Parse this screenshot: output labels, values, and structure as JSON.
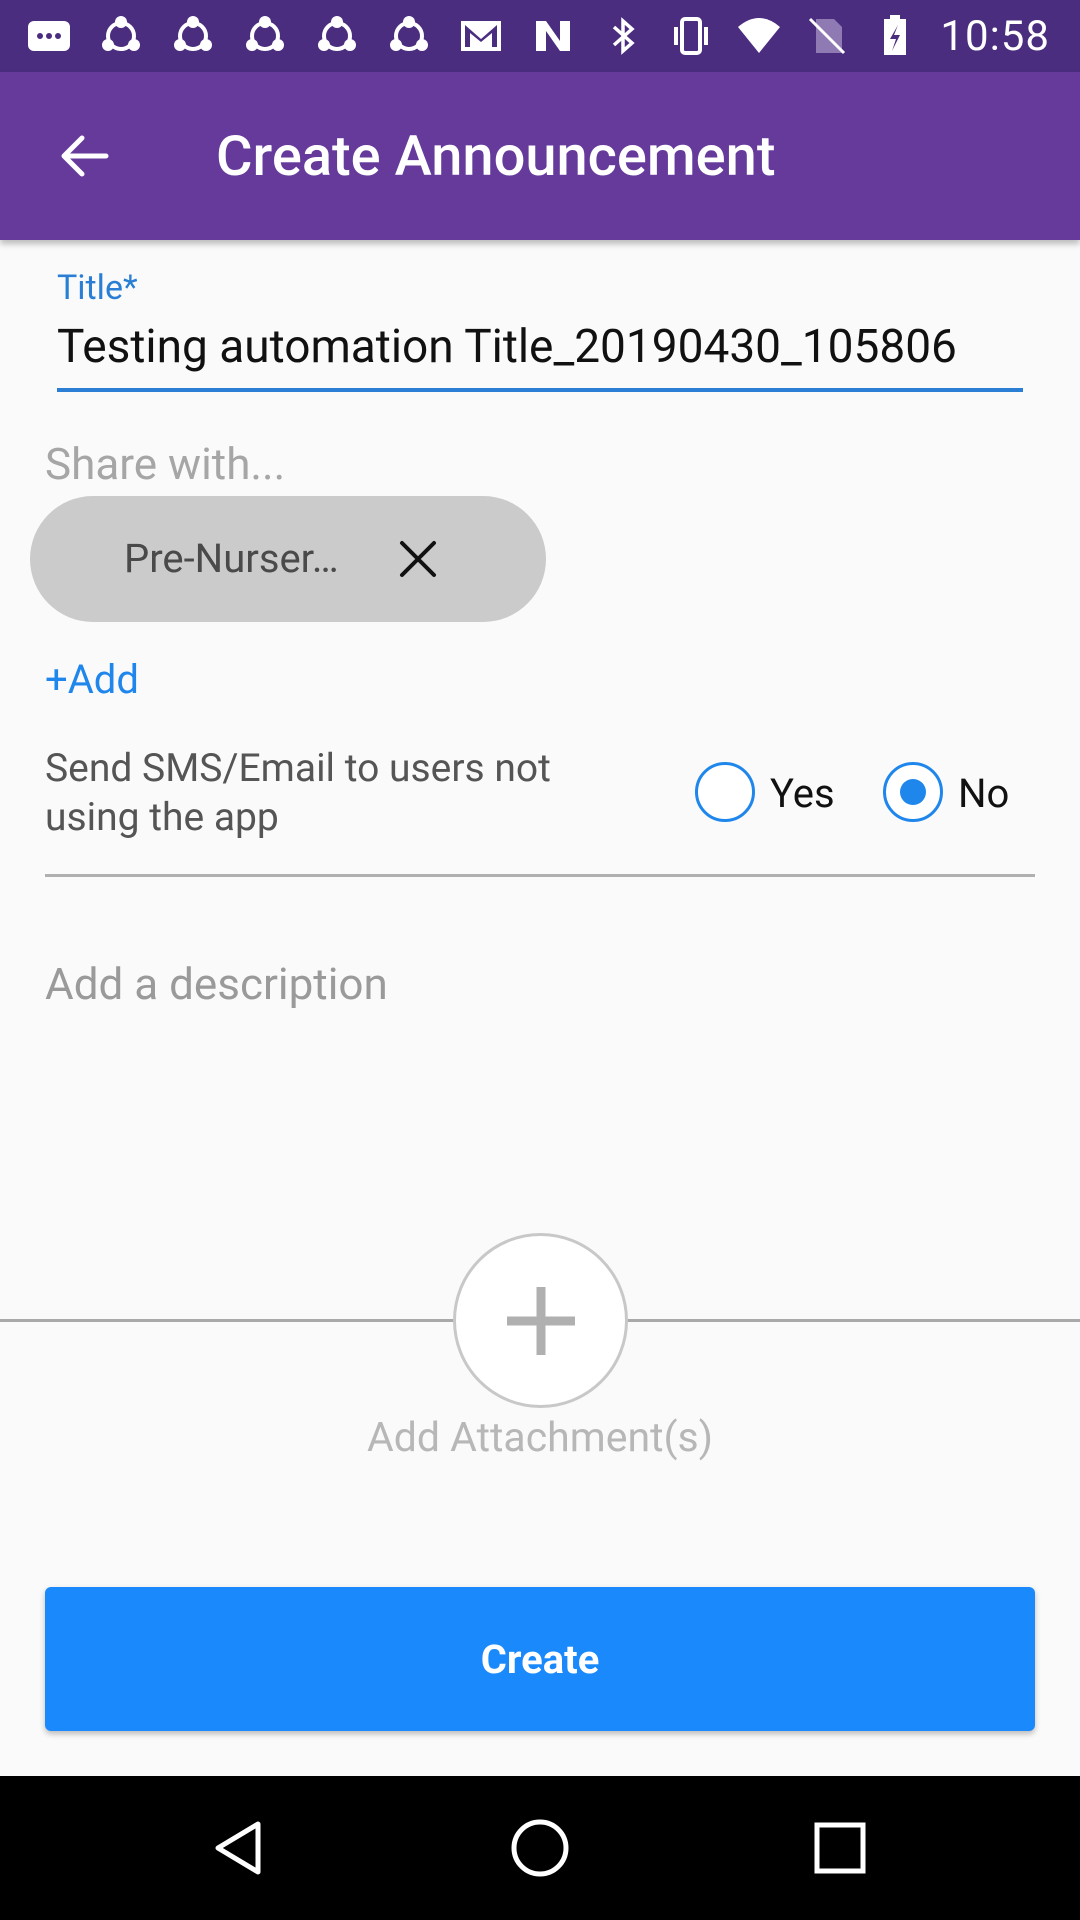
{
  "status_bar": {
    "time": "10:58",
    "icons": [
      "message-icon",
      "share-icon",
      "share-icon",
      "share-icon",
      "share-icon",
      "share-icon",
      "gmail-icon",
      "n-icon",
      "bluetooth-icon",
      "vibrate-icon",
      "wifi-icon",
      "no-sim-icon",
      "battery-icon"
    ]
  },
  "app_bar": {
    "back_icon": "arrow-back-icon",
    "title": "Create Announcement"
  },
  "form": {
    "title_label": "Title*",
    "title_value": "Testing automation Title_20190430_105806",
    "share_placeholder": "Share with...",
    "chips": [
      {
        "label": "Pre-Nurser…",
        "close_icon": "close-icon"
      }
    ],
    "add_link": "+Add",
    "sms_label": "Send SMS/Email to users not using the app",
    "sms_options": [
      {
        "label": "Yes",
        "selected": false
      },
      {
        "label": "No",
        "selected": true
      }
    ],
    "description_placeholder": "Add a description",
    "attachment_label": "Add Attachment(s)",
    "attachment_icon": "plus-icon"
  },
  "create_button": {
    "label": "Create"
  },
  "navigation": {
    "back_icon": "nav-back-icon",
    "home_icon": "nav-home-icon",
    "recents_icon": "nav-recents-icon"
  },
  "colors": {
    "status_bar": "#4b2d7f",
    "app_bar": "#653a9b",
    "accent": "#1a89fb",
    "label_blue": "#2a7fd4",
    "chip": "#cccbcc"
  }
}
